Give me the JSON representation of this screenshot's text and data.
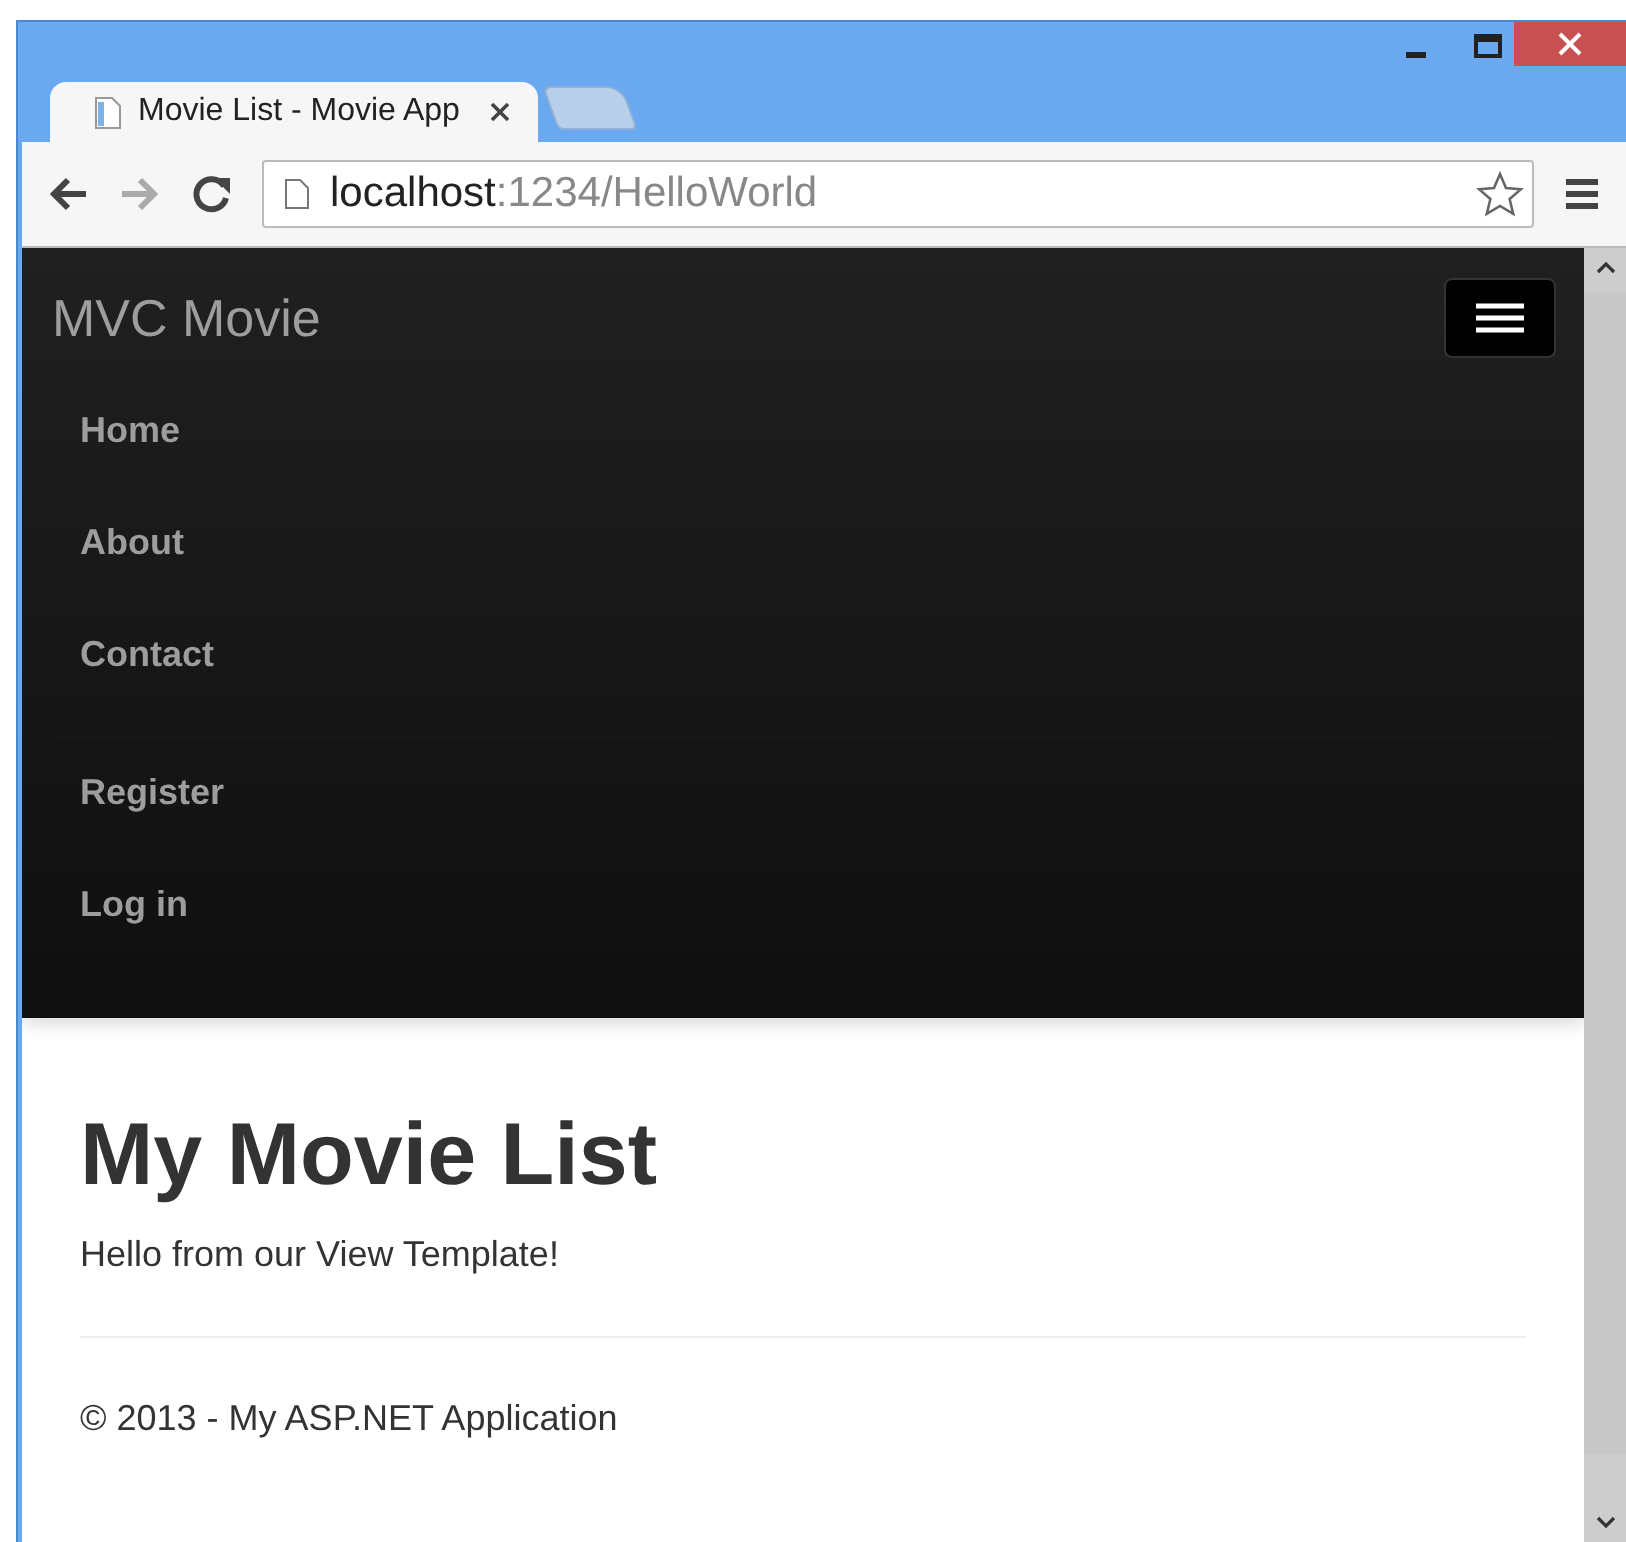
{
  "browser": {
    "tabs": [
      {
        "title": "Movie List - Movie App",
        "selected": true
      }
    ],
    "address": {
      "host": "localhost",
      "path": ":1234/HelloWorld"
    }
  },
  "navbar": {
    "brand": "MVC Movie",
    "menu_expanded": true,
    "links": [
      "Home",
      "About",
      "Contact"
    ],
    "account_links": [
      "Register",
      "Log in"
    ]
  },
  "content": {
    "heading": "My Movie List",
    "text": "Hello from our View Template!"
  },
  "footer": "© 2013 - My ASP.NET Application"
}
